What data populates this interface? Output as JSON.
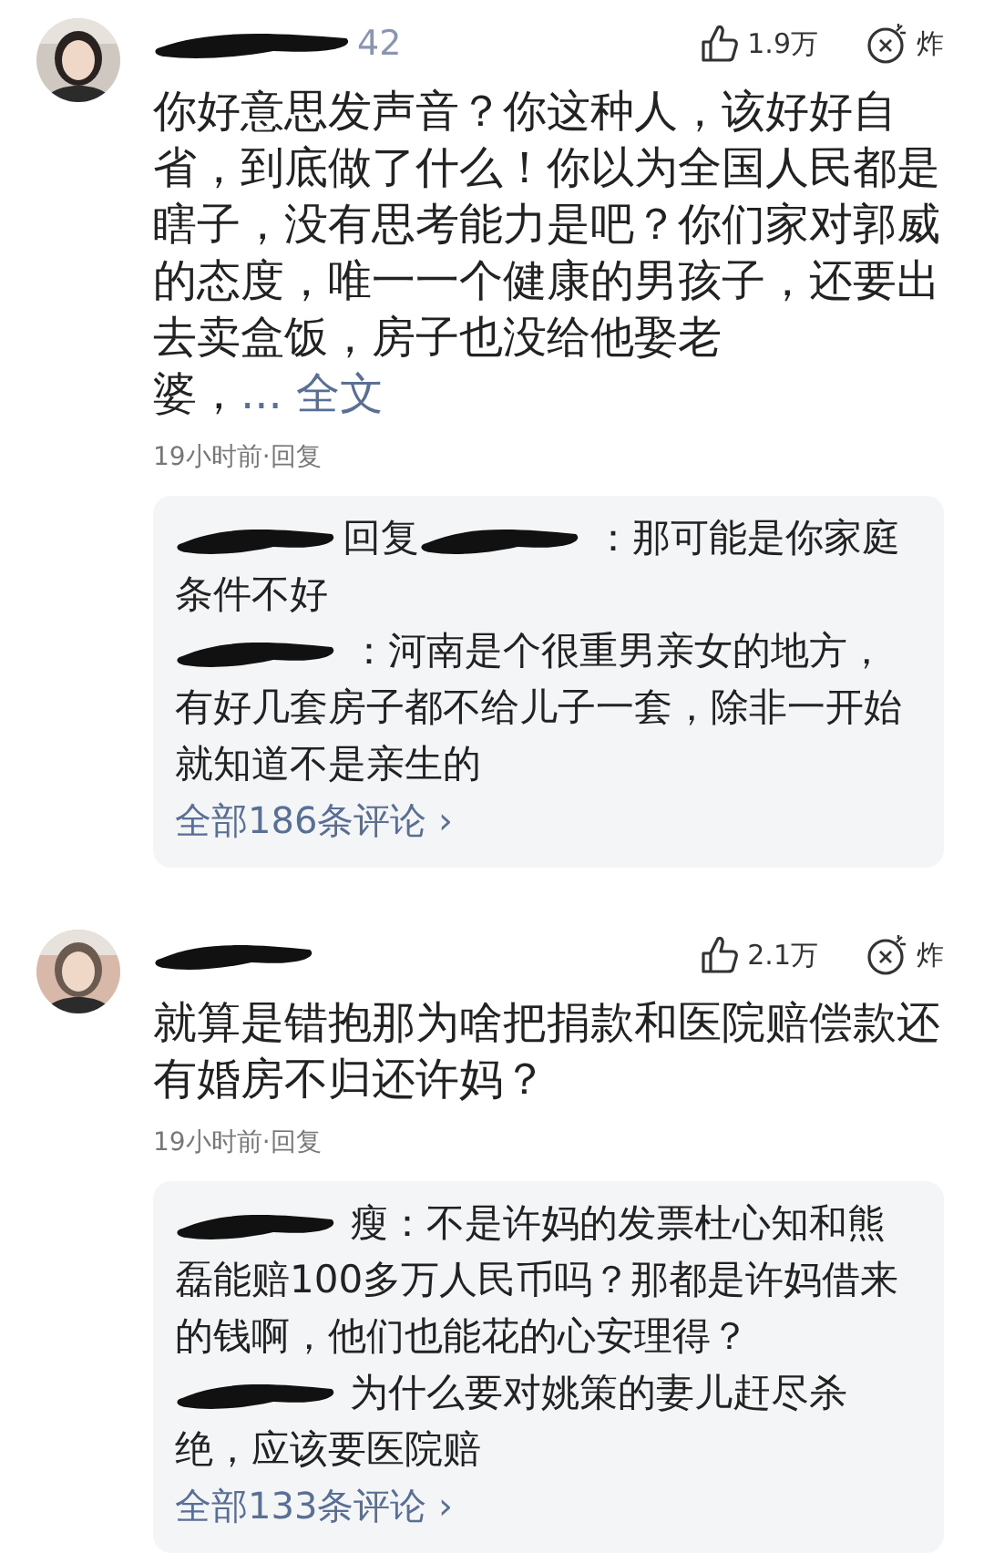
{
  "comments": [
    {
      "avatar": {
        "kind": "picture"
      },
      "name": [
        {
          "kind": "redaction"
        },
        {
          "kind": "text",
          "text": "42"
        }
      ],
      "likes": "1.9万",
      "bomb_label": "炸",
      "text": "你好意思发声音？你这种人，该好好自省，到底做了什么！你以为全国人民都是瞎子，没有思考能力是吧？你们家对郭威的态度，唯一一个健康的男孩子，还要出去卖盒饭，房子也没给他娶老婆，",
      "more_link": "... 全文",
      "time": "19小时前·回复",
      "replies": [
        {
          "lines": [
            [
              {
                "kind": "redaction"
              },
              {
                "kind": "label",
                "text": "回复"
              },
              {
                "kind": "redaction"
              },
              {
                "kind": "text",
                "text": "：那可能是你家庭"
              }
            ],
            [
              {
                "kind": "text",
                "text": "条件不好"
              }
            ]
          ]
        },
        {
          "lines": [
            [
              {
                "kind": "redaction"
              },
              {
                "kind": "text",
                "text": "：河南是个很重男亲女的地方，"
              }
            ],
            [
              {
                "kind": "text",
                "text": "有好几套房子都不给儿子一套，除非一开始"
              }
            ],
            [
              {
                "kind": "text",
                "text": "就知道不是亲生的"
              }
            ]
          ]
        }
      ],
      "all_link": "全部186条评论 ›"
    },
    {
      "avatar": {
        "kind": "picture"
      },
      "name": [
        {
          "kind": "redaction"
        }
      ],
      "likes": "2.1万",
      "bomb_label": "炸",
      "text": "就算是错抱那为啥把捐款和医院赔偿款还有婚房不归还许妈？",
      "time": "19小时前·回复",
      "replies": [
        {
          "lines": [
            [
              {
                "kind": "redaction"
              },
              {
                "kind": "text",
                "text": "瘦：不是许妈的发票杜心知和熊"
              }
            ],
            [
              {
                "kind": "text",
                "text": "磊能赔100多万人民币吗？那都是许妈借来"
              }
            ],
            [
              {
                "kind": "text",
                "text": "的钱啊，他们也能花的心安理得？"
              }
            ]
          ]
        },
        {
          "lines": [
            [
              {
                "kind": "redaction"
              },
              {
                "kind": "text",
                "text": "为什么要对姚策的妻儿赶尽杀"
              }
            ],
            [
              {
                "kind": "text",
                "text": "绝，应该要医院赔"
              }
            ]
          ]
        }
      ],
      "all_link": "全部133条评论 ›"
    }
  ]
}
